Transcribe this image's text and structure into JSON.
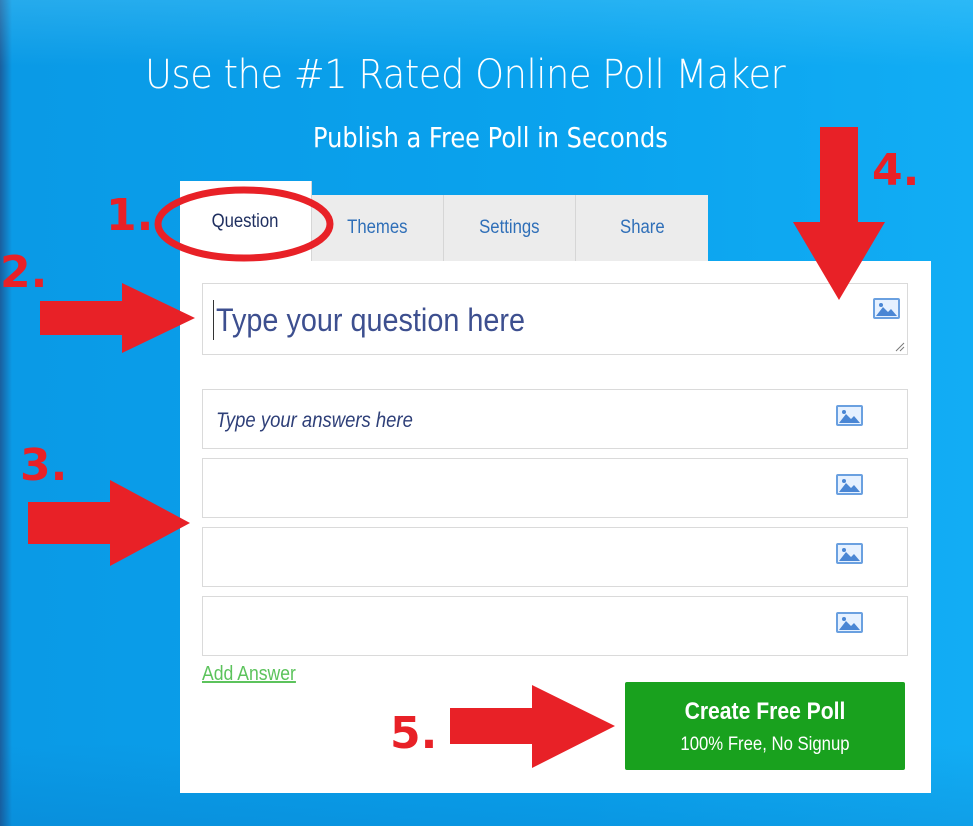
{
  "header": {
    "title": "Use the #1 Rated Online Poll Maker",
    "subtitle": "Publish a Free Poll in Seconds"
  },
  "tabs": [
    {
      "label": "Question",
      "active": true
    },
    {
      "label": "Themes",
      "active": false
    },
    {
      "label": "Settings",
      "active": false
    },
    {
      "label": "Share",
      "active": false
    }
  ],
  "question": {
    "placeholder": "Type your question here"
  },
  "answers": [
    {
      "placeholder": "Type your answers here"
    },
    {
      "placeholder": ""
    },
    {
      "placeholder": ""
    },
    {
      "placeholder": ""
    }
  ],
  "add_answer_label": "Add Answer",
  "create_button": {
    "label": "Create Free Poll",
    "sublabel": "100% Free, No Signup"
  },
  "annotations": [
    "1.",
    "2.",
    "3.",
    "4.",
    "5."
  ],
  "colors": {
    "background": "#0aa3ee",
    "annotation_red": "#e82127",
    "button_green": "#19a11e",
    "link_green": "#5cc35c",
    "tab_text": "#2f6fb8"
  },
  "icons": [
    "image-upload-icon"
  ]
}
